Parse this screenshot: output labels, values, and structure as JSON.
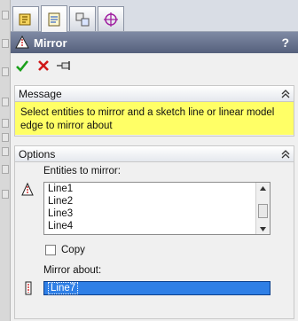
{
  "tabs": [
    {
      "icon": "featuremanager-icon",
      "active": false
    },
    {
      "icon": "propertymanager-icon",
      "active": true
    },
    {
      "icon": "configurationmanager-icon",
      "active": false
    },
    {
      "icon": "dimxpertmanager-icon",
      "active": false
    }
  ],
  "title": "Mirror",
  "help_label": "?",
  "actions": {
    "ok_icon": "checkmark-icon",
    "cancel_icon": "x-icon",
    "pushpin_icon": "pushpin-icon"
  },
  "message": {
    "header": "Message",
    "text": "Select entities to mirror and a sketch line or linear model edge to mirror about"
  },
  "options": {
    "header": "Options",
    "entities_label": "Entities to mirror:",
    "entities": [
      "Line1",
      "Line2",
      "Line3",
      "Line4"
    ],
    "copy_label": "Copy",
    "copy_checked": false,
    "mirror_about_label": "Mirror about:",
    "mirror_about_value": "Line7"
  },
  "colors": {
    "titlebar": "#5f6a86",
    "message_bg": "#ffff66",
    "selection": "#2f7fe6"
  }
}
